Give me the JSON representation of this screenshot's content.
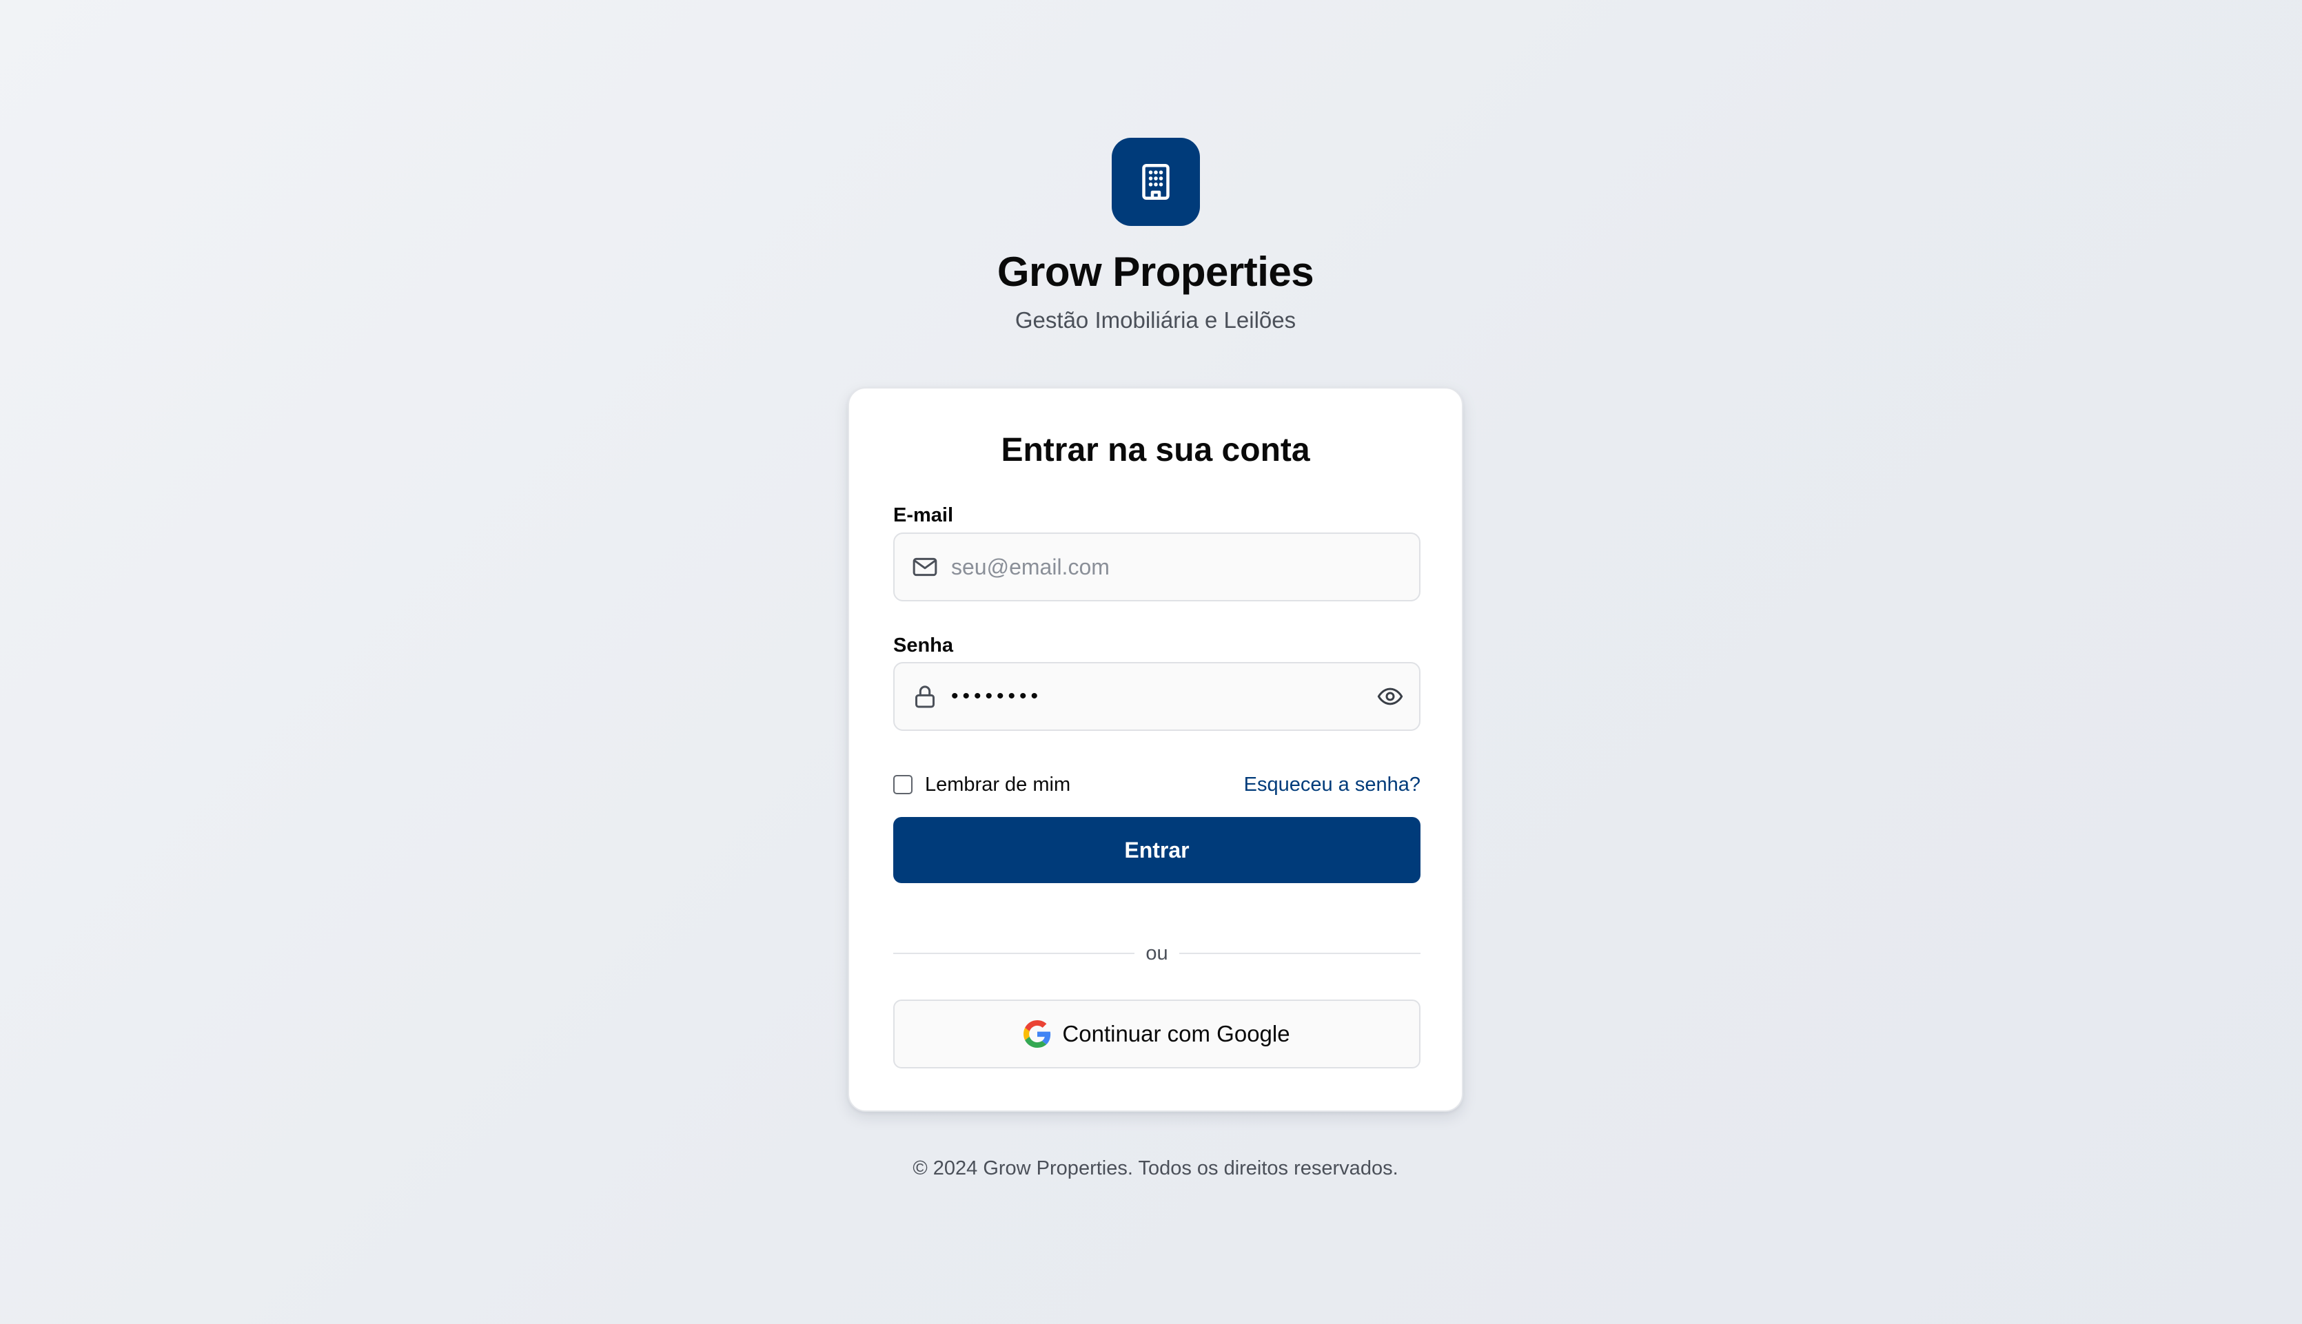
{
  "brand": {
    "title": "Grow Properties",
    "subtitle": "Gestão Imobiliária e Leilões",
    "logo_icon": "building-icon",
    "accent_color": "#003b7a"
  },
  "login": {
    "title": "Entrar na sua conta",
    "email": {
      "label": "E-mail",
      "placeholder": "seu@email.com",
      "value": "",
      "icon": "mail-icon"
    },
    "password": {
      "label": "Senha",
      "value": "••••••••",
      "icon": "lock-icon",
      "toggle_icon": "eye-icon"
    },
    "remember_label": "Lembrar de mim",
    "remember_checked": false,
    "forgot_label": "Esqueceu a senha?",
    "submit_label": "Entrar",
    "divider_label": "ou",
    "google_label": "Continuar com Google",
    "google_icon": "google-icon"
  },
  "footer": {
    "text": "© 2024 Grow Properties. Todos os direitos reservados."
  }
}
